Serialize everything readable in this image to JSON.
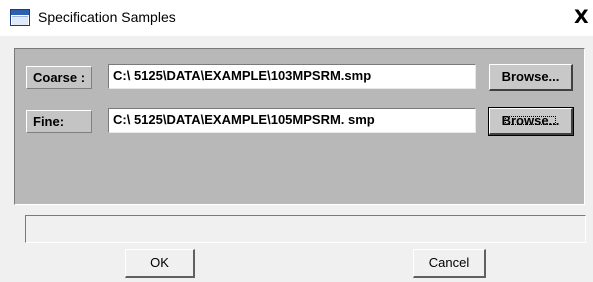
{
  "window": {
    "title": "Specification Samples",
    "close_glyph": "X",
    "icon": "window-app-icon"
  },
  "coarse": {
    "label": "Coarse :",
    "path": "C:\\ 5125\\DATA\\EXAMPLE\\103MPSRM.smp",
    "browse_label": "Browse..."
  },
  "fine": {
    "label": "Fine:",
    "path": "C:\\ 5125\\DATA\\EXAMPLE\\105MPSRM. smp",
    "browse_label": "Browse..."
  },
  "status": {
    "text": ""
  },
  "buttons": {
    "ok_label": "OK",
    "cancel_label": "Cancel"
  }
}
